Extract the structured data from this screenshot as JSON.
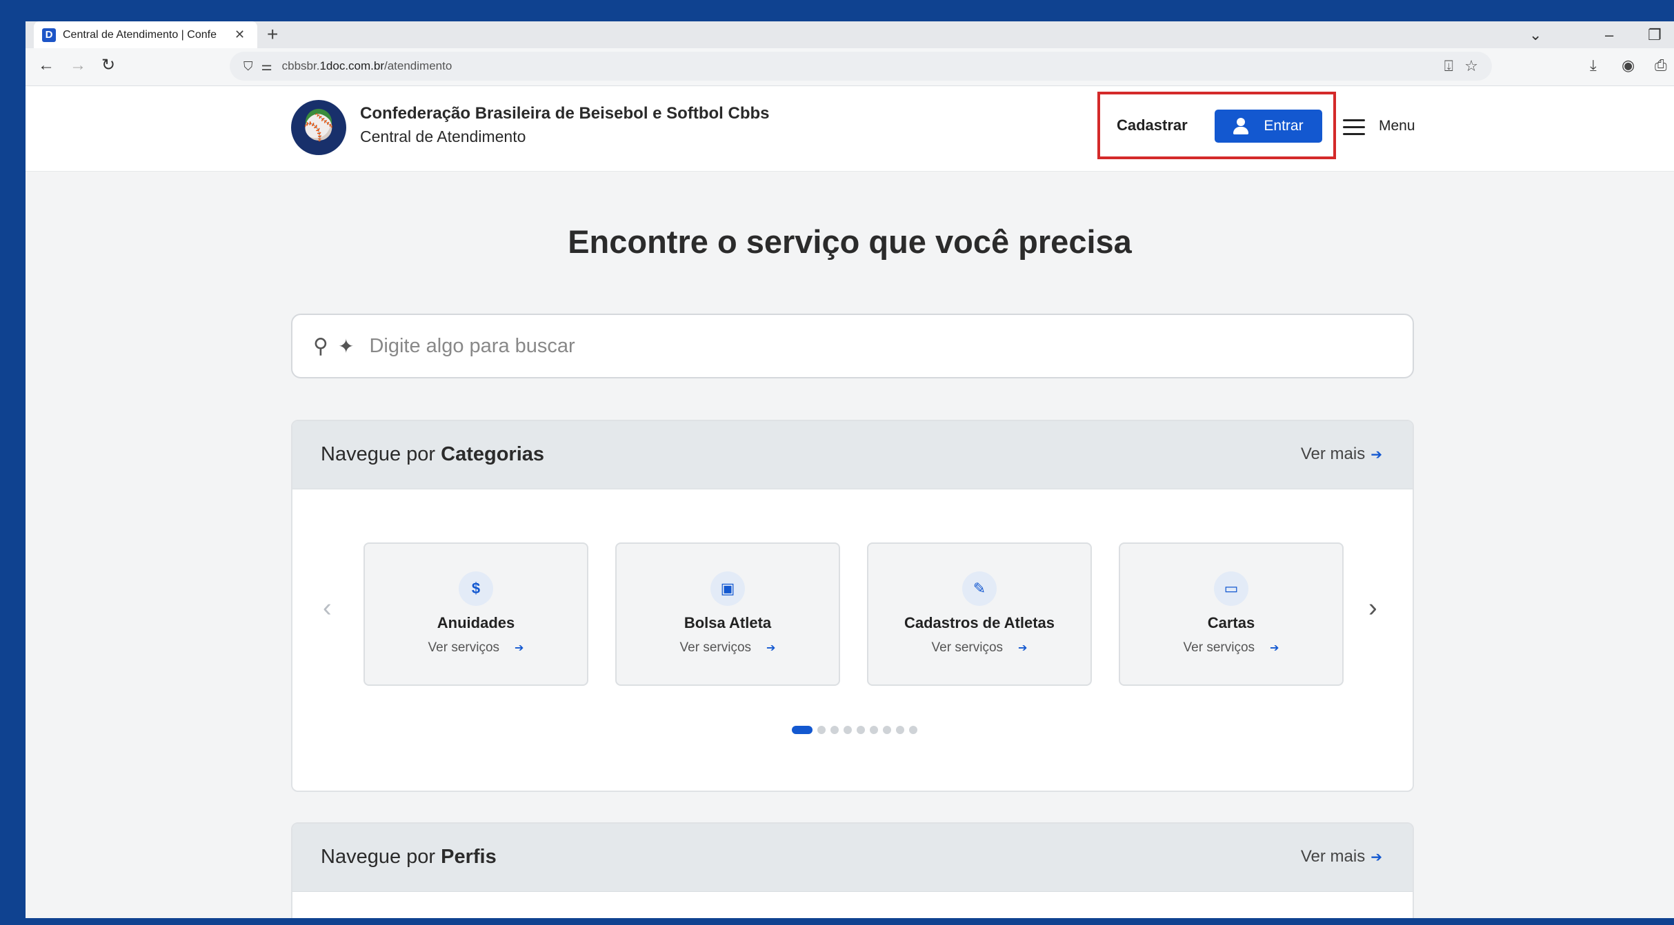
{
  "browser": {
    "tab_title": "Central de Atendimento | Confe",
    "favicon_letter": "D",
    "url_prefix": "cbbsbr.",
    "url_domain": "1doc.com.br",
    "url_path": "/atendimento"
  },
  "header": {
    "org_name": "Confederação Brasileira de Beisebol e Softbol Cbbs",
    "org_subtitle": "Central de Atendimento",
    "signup_label": "Cadastrar",
    "login_label": "Entrar",
    "menu_label": "Menu"
  },
  "hero": {
    "title": "Encontre o serviço que você precisa"
  },
  "search": {
    "placeholder": "Digite algo para buscar"
  },
  "categories": {
    "title_prefix": "Navegue por ",
    "title_bold": "Categorias",
    "see_more": "Ver mais",
    "cards": [
      {
        "title": "Anuidades",
        "link": "Ver serviços",
        "icon": "dollar-icon"
      },
      {
        "title": "Bolsa Atleta",
        "link": "Ver serviços",
        "icon": "money-icon"
      },
      {
        "title": "Cadastros de Atletas",
        "link": "Ver serviços",
        "icon": "pencil-icon"
      },
      {
        "title": "Cartas",
        "link": "Ver serviços",
        "icon": "book-icon"
      }
    ],
    "page_count": 9,
    "active_page": 1
  },
  "profiles": {
    "title_prefix": "Navegue por ",
    "title_bold": "Perfis",
    "see_more": "Ver mais"
  },
  "colors": {
    "accent": "#1358d0",
    "highlight": "#d42a2a",
    "desktop": "#0f4290"
  }
}
